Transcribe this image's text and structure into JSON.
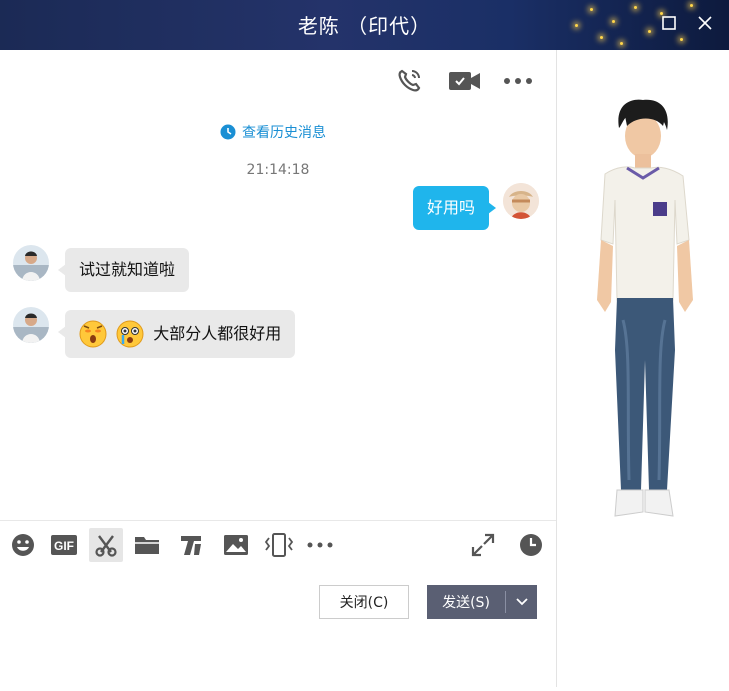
{
  "window": {
    "title": "老陈 （印代）",
    "maximize_icon": "maximize-icon",
    "close_icon": "close-icon"
  },
  "top_tools": [
    "phone-call-icon",
    "video-call-icon",
    "more-icon"
  ],
  "history_link": "查看历史消息",
  "timestamp": "21:14:18",
  "messages": [
    {
      "from": "self",
      "text": "好用吗"
    },
    {
      "from": "other",
      "text": "试过就知道啦"
    },
    {
      "from": "other",
      "text": "大部分人都很好用",
      "emojis": [
        "shocked-emoji",
        "crying-emoji"
      ]
    }
  ],
  "toolbar": [
    "emoji-icon",
    "gif-icon",
    "scissors-icon",
    "folder-icon",
    "font-icon",
    "image-icon",
    "shake-icon",
    "more-icon",
    "expand-icon",
    "clock-icon"
  ],
  "buttons": {
    "close": "关闭(C)",
    "send": "发送(S)"
  },
  "colors": {
    "accent": "#1fb5ec",
    "link": "#1a8fd4",
    "send_button": "#5a5f73"
  }
}
